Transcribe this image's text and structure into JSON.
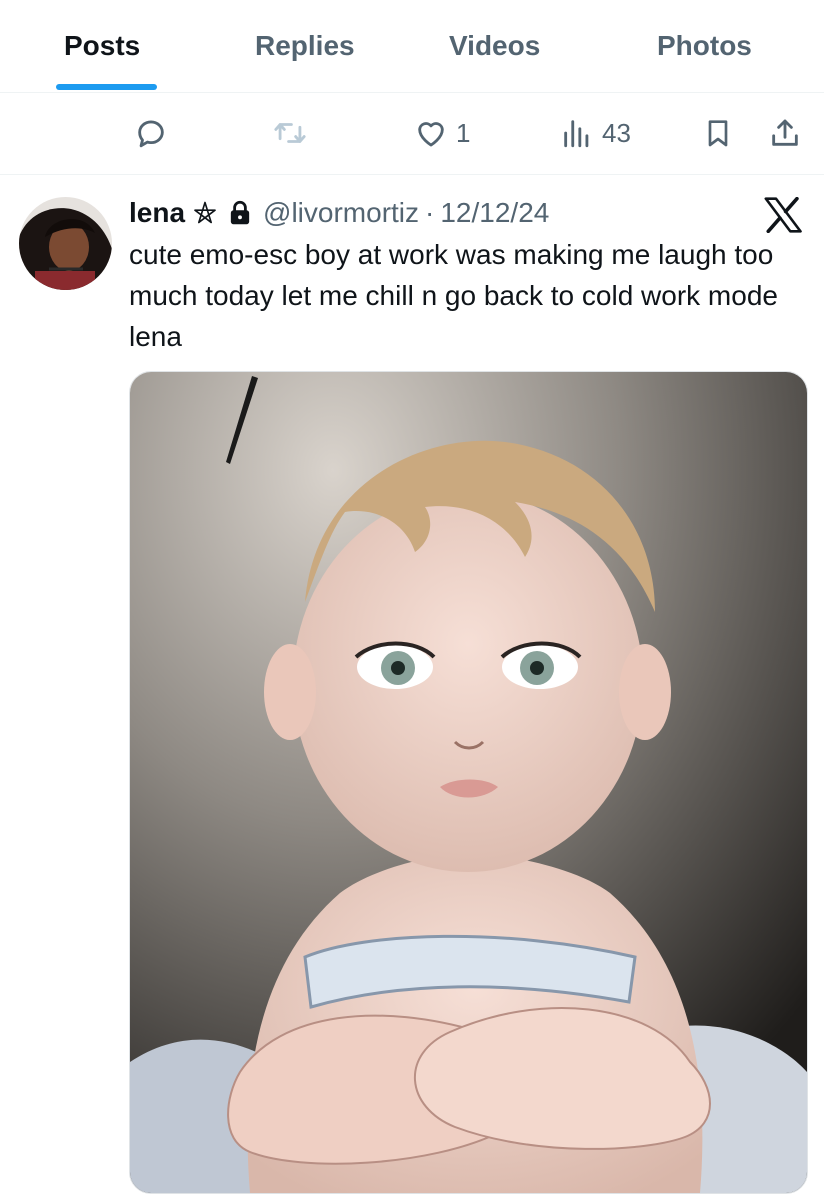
{
  "tabs": [
    {
      "label": "Posts",
      "active": true
    },
    {
      "label": "Replies",
      "active": false
    },
    {
      "label": "Videos",
      "active": false
    },
    {
      "label": "Photos",
      "active": false
    }
  ],
  "actions": {
    "reply_icon": "reply-icon",
    "retweet_icon": "retweet-icon",
    "like_icon": "heart-icon",
    "like_count": "1",
    "views_icon": "views-icon",
    "views_count": "43",
    "bookmark_icon": "bookmark-icon",
    "share_icon": "share-icon"
  },
  "tweet": {
    "name": "lena",
    "name_badge_icon": "pentagram-icon",
    "protected_icon": "lock-icon",
    "handle": "@livormortiz",
    "separator": "·",
    "date": "12/12/24",
    "source_icon": "x-logo-icon",
    "text": "cute emo-esc boy at work was making me laugh too much today let me chill n go back to cold work mode lena"
  },
  "colors": {
    "accent": "#1d9bf0",
    "text_primary": "#0f1419",
    "text_secondary": "#536471",
    "retweet_disabled": "#b9cad6"
  }
}
